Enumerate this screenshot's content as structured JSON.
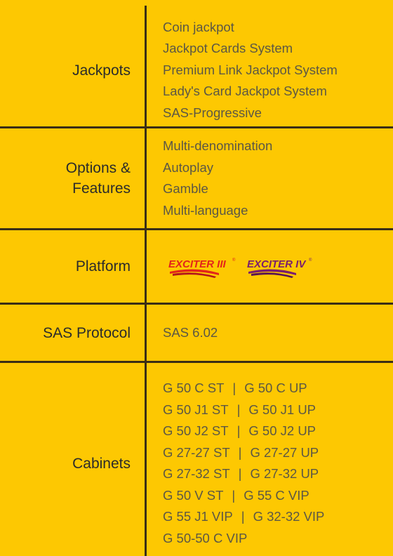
{
  "rows": {
    "jackpots": {
      "label": "Jackpots",
      "items": [
        "Coin jackpot",
        "Jackpot Cards System",
        "Premium Link Jackpot System",
        "Lady's Card Jackpot System",
        "SAS-Progressive"
      ]
    },
    "options": {
      "label_line1": "Options &",
      "label_line2": "Features",
      "items": [
        "Multi-denomination",
        "Autoplay",
        "Gamble",
        "Multi-language"
      ]
    },
    "platform": {
      "label": "Platform",
      "logos": [
        {
          "text": "EXCITER III",
          "color": "#E3241B",
          "mark": "®"
        },
        {
          "text": "EXCITER IV",
          "color": "#7A1E6E",
          "mark": "®"
        }
      ]
    },
    "sas": {
      "label": "SAS Protocol",
      "value": "SAS 6.02"
    },
    "cabinets": {
      "label": "Cabinets",
      "pairs": [
        {
          "left": "G 50 C ST",
          "sep": "|",
          "right": "G 50 C UP"
        },
        {
          "left": "G 50 J1 ST",
          "sep": "|",
          "right": "G 50 J1 UP"
        },
        {
          "left": "G 50 J2 ST",
          "sep": "|",
          "right": "G 50 J2 UP"
        },
        {
          "left": "G 27-27 ST",
          "sep": "|",
          "right": "G 27-27 UP"
        },
        {
          "left": "G 27-32 ST",
          "sep": "|",
          "right": "G 27-32 UP"
        },
        {
          "left": "G 50 V ST",
          "sep": "|",
          "right": "G 55 C VIP"
        },
        {
          "left": "G 55 J1 VIP",
          "sep": "|",
          "right": "G 32-32 VIP"
        },
        {
          "left": "G 50-50 C VIP",
          "sep": "",
          "right": ""
        }
      ]
    }
  },
  "colors": {
    "background": "#FDC802",
    "divider": "#3a2e16",
    "label_text": "#2b2b2b",
    "value_text": "#5c5745"
  }
}
